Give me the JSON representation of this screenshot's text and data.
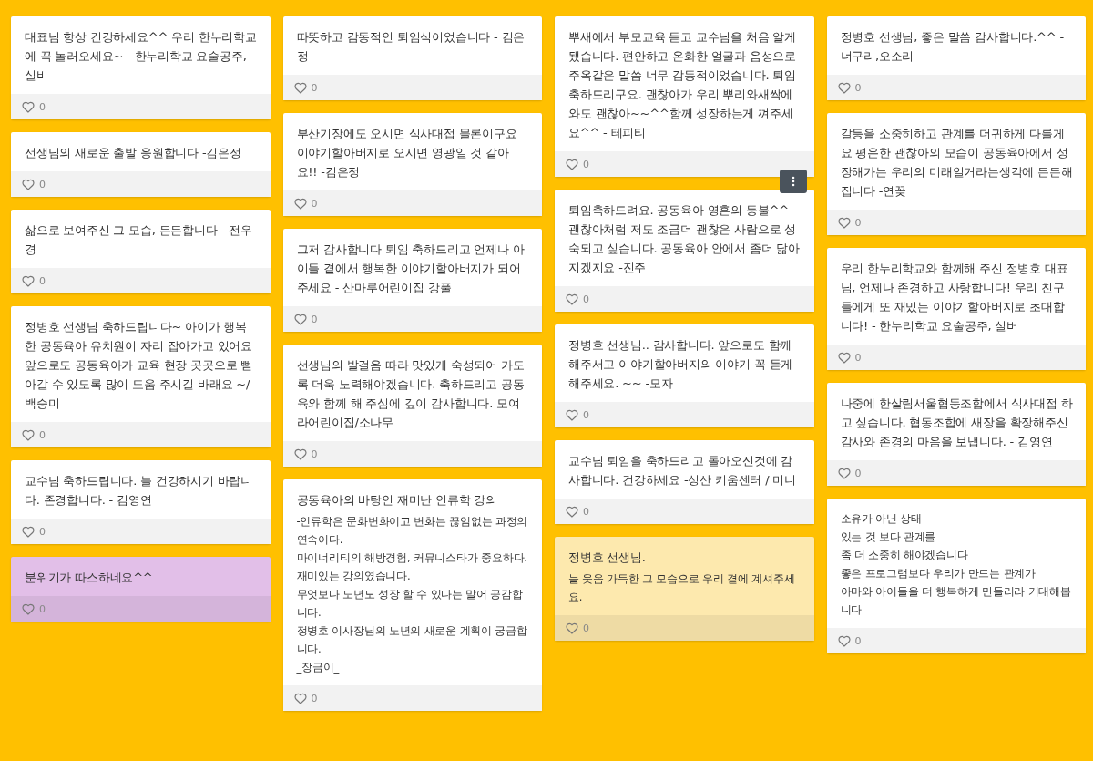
{
  "columns": [
    {
      "posts": [
        {
          "title": "대표님 항상 건강하세요^^ 우리 한누리학교에 꼭 놀러오세요~ - 한누리학교 요술공주,실비",
          "likes": "0"
        },
        {
          "title": "선생님의 새로운 출발 응원합니다  -김은정",
          "likes": "0"
        },
        {
          "title": "삶으로 보여주신 그 모습, 든든합니다 - 전우경",
          "likes": "0"
        },
        {
          "title": "정병호 선생님 축하드립니다~ 아이가 행복한 공동육아 유치원이 자리 잡아가고 있어요 앞으로도 공동육아가  교육 현장 곳곳으로 뻗아갈 수 있도록 많이 도움 주시길 바래요 ~/백승미",
          "likes": "0"
        },
        {
          "title": "교수님 축하드립니다. 늘 건강하시기 바랍니다. 존경합니다.  - 김영연",
          "likes": "0"
        },
        {
          "title": "분위기가 따스하네요^^",
          "likes": "0",
          "color": "#e2bfe8"
        }
      ]
    },
    {
      "posts": [
        {
          "title": "따뜻하고 감동적인 퇴임식이었습니다  - 김은정",
          "likes": "0"
        },
        {
          "title": "부산기장에도 오시면 식사대접 물론이구요 이야기할아버지로 오시면 영광일 것 같아요!! -김은정",
          "likes": "0"
        },
        {
          "title": "그저 감사합니다 퇴임 축하드리고 언제나 아이들 곁에서 행복한 이야기할아버지가 되어주세요  - 산마루어린이집 강풀",
          "likes": "0"
        },
        {
          "title": "선생님의 발걸음 따라 맛있게 숙성되어 가도록 더욱 노력해야겠습니다.  축하드리고 공동육와 함께 해 주심에 깊이 감사합니다. 모여라어린이집/소나무",
          "likes": "0"
        },
        {
          "title": "공동육아의 바탕인 재미난 인류학 강의",
          "lines": [
            "-인류학은 문화변화이고 변화는 끊임없는 과정의 연속이다.",
            "마이너리티의 해방경험, 커뮤니스타가 중요하다.",
            "재미있는 강의였습니다.",
            "무엇보다 노년도 성장 할 수 있다는 말어 공감합니다.",
            "정병호 이사장님의 노년의 새로운 계획이 궁금합니다.",
            "_장금이_"
          ],
          "likes": "0"
        }
      ]
    },
    {
      "posts": [
        {
          "title": "뿌새에서 부모교육 듣고 교수님을 처음 알게 됐습니다. 편안하고 온화한 얼굴과 음성으로 주옥같은 말씀 너무 감동적이었습니다. 퇴임 축하드리구요. 괜찮아가 우리 뿌리와새싹에 와도 괜찮아~~^^함께 성장하는게 껴주세요^^  - 테피티",
          "likes": "0"
        },
        {
          "title": "퇴임축하드려요. 공동육아 영혼의  등불^^ 괜찮아처럼 저도 조금더 괜찮은 사람으로 성숙되고 싶습니다.  공동육아 안에서 좀더 닮아지겠지요 -진주",
          "likes": "0",
          "menu": true
        },
        {
          "title": "정병호 선생님.. 감사합니다.  앞으로도 함께 해주서고 이야기할아버지의 이야기 꼭 듣게 해주세요. ~~  -모자",
          "likes": "0"
        },
        {
          "title": "교수님 퇴임을 축하드리고 돌아오신것에 감사합니다. 건강하세요 -성산 키움센터 / 미니",
          "likes": "0"
        },
        {
          "title": "정병호 선생님.",
          "lines": [
            "늘 웃음 가득한 그 모습으로 우리 곁에 계셔주세요."
          ],
          "likes": "0",
          "color": "#fde9ae"
        }
      ]
    },
    {
      "posts": [
        {
          "title": "정병호 선생님, 좋은 말씀 감사합니다.^^ - 너구리,오소리",
          "likes": "0"
        },
        {
          "title": "갈등을 소중히하고 관계를 더귀하게 다룰게요 평온한 괜찮아의 모습이 공동육아에서 성장해가는 우리의 미래일거라는생각에 든든해집니다 -연꽂",
          "likes": "0"
        },
        {
          "title": "우리 한누리학교와 함께해 주신 정병호 대표님, 언제나 존경하고 사랑합니다! 우리 친구들에게 또 재밌는 이야기할아버지로 초대합니다! - 한누리학교 요술공주, 실버",
          "likes": "0"
        },
        {
          "title": "나중에 한살림서울협동조합에서 식사대접 하고 싶습니다. 협동조합에 새장을 확장해주신 감사와 존경의 마음을 보냅니다. - 김영연",
          "likes": "0"
        },
        {
          "lines": [
            "소유가 아닌 상태",
            "있는 것 보다 관계를",
            "좀 더 소중히 해야겠습니다",
            "좋은 프로그램보다 우리가 만드는 관계가",
            "아마와 아이들을 더 행복하게 만들리라 기대해봅니다"
          ],
          "likes": "0"
        }
      ]
    }
  ]
}
